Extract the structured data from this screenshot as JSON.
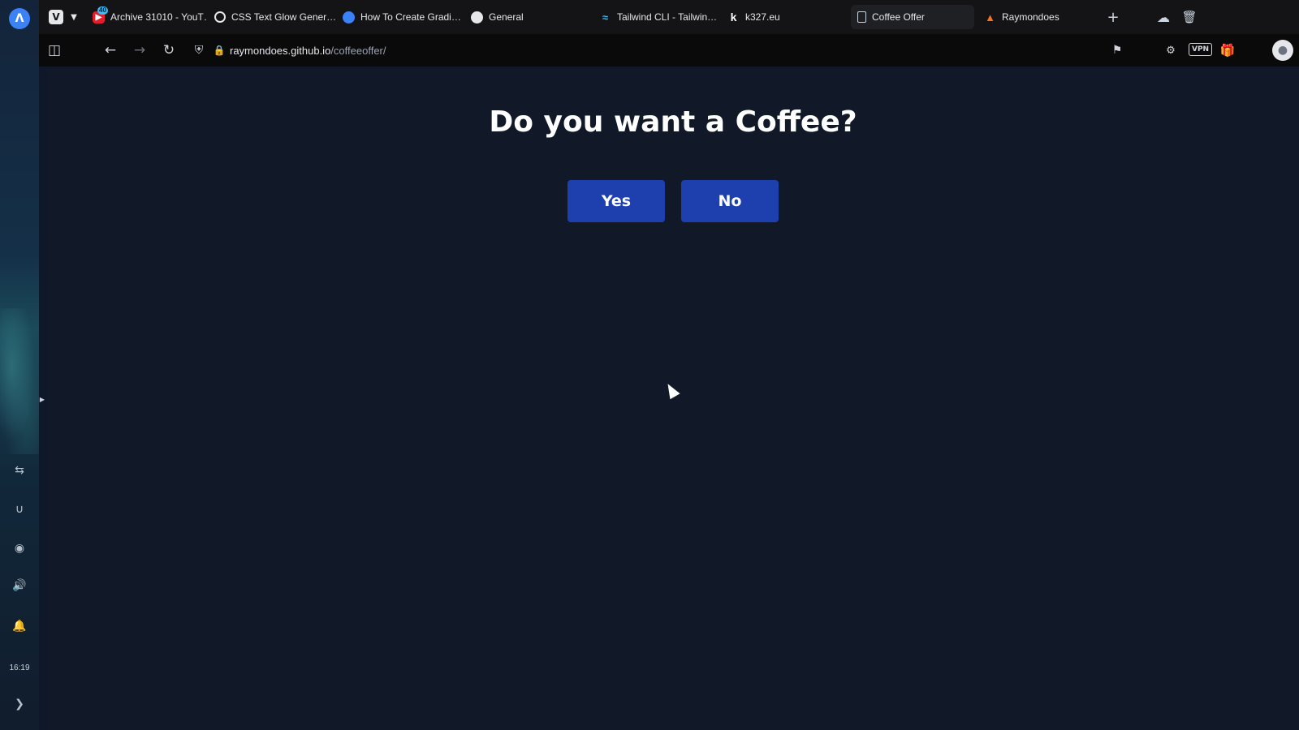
{
  "browser": {
    "tabs": [
      {
        "label": "Archive 31010 - YouT…",
        "badge": "40",
        "icon": "youtube-icon"
      },
      {
        "label": "CSS Text Glow Gener…",
        "icon": "css-icon"
      },
      {
        "label": "How To Create Gradi…",
        "icon": "gradient-icon"
      },
      {
        "label": "General",
        "icon": "github-icon"
      },
      {
        "label": "Tailwind CLI - Tailwin…",
        "icon": "tailwind-icon"
      },
      {
        "label": "k327.eu",
        "icon": "k-icon"
      },
      {
        "label": "Coffee Offer",
        "icon": "document-icon",
        "active": true
      },
      {
        "label": "Raymondoes",
        "icon": "fire-icon"
      }
    ],
    "address": {
      "host": "raymondoes.github.io",
      "path": "/coffeeoffer/"
    },
    "vpn_label": "VPN",
    "sidebar_time": "16:19"
  },
  "page": {
    "title": "Do you want a Coffee?",
    "yes_label": "Yes",
    "no_label": "No"
  },
  "colors": {
    "page_background": "#111827",
    "button_background": "#1e40af",
    "button_text": "#ffffff",
    "title_text": "#ffffff"
  }
}
